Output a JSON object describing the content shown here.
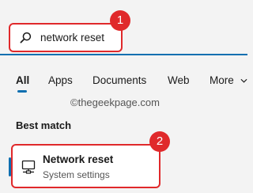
{
  "search": {
    "query": "network reset"
  },
  "annotations": {
    "step1": "1",
    "step2": "2"
  },
  "tabs": [
    {
      "label": "All",
      "active": true
    },
    {
      "label": "Apps"
    },
    {
      "label": "Documents"
    },
    {
      "label": "Web"
    },
    {
      "label": "More"
    }
  ],
  "watermark": "©thegeekpage.com",
  "best_match": {
    "heading": "Best match",
    "title": "Network reset",
    "subtitle": "System settings",
    "icon": "network-computer-icon"
  },
  "colors": {
    "accent": "#0e6fb0",
    "highlight": "#e0292b",
    "background": "#f3f3f3"
  }
}
